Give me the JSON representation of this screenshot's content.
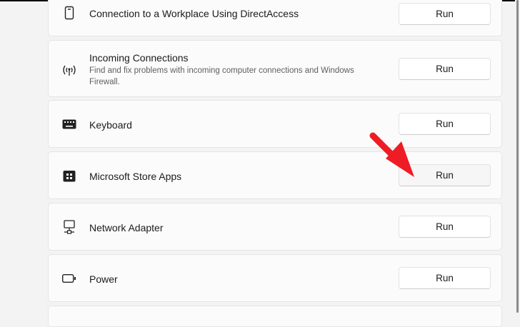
{
  "troubleshooters": [
    {
      "title": "Connection to a Workplace Using DirectAccess",
      "icon": "phone-icon",
      "button": "Run"
    },
    {
      "title": "Incoming Connections",
      "description": "Find and fix problems with incoming computer connections and Windows Firewall.",
      "icon": "antenna-icon",
      "button": "Run"
    },
    {
      "title": "Keyboard",
      "icon": "keyboard-icon",
      "button": "Run"
    },
    {
      "title": "Microsoft Store Apps",
      "icon": "store-icon",
      "button": "Run"
    },
    {
      "title": "Network Adapter",
      "icon": "network-icon",
      "button": "Run"
    },
    {
      "title": "Power",
      "icon": "battery-icon",
      "button": "Run"
    }
  ],
  "colors": {
    "arrow": "#ee1c24"
  }
}
